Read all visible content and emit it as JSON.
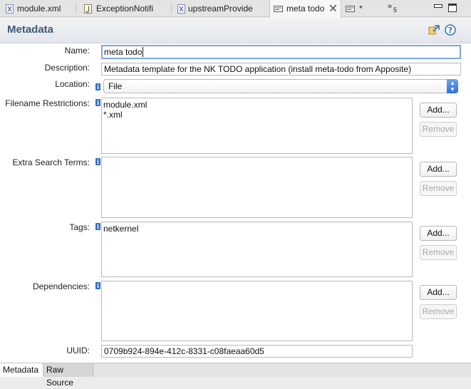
{
  "tabs": [
    {
      "label": "module.xml",
      "icon": "xml-file-icon"
    },
    {
      "label": "ExceptionNotifi",
      "icon": "java-file-icon"
    },
    {
      "label": "upstreamProvide",
      "icon": "xml-file-icon"
    },
    {
      "label": "meta todo",
      "icon": "metadata-editor-icon",
      "active": true
    },
    {
      "label": "*",
      "icon": "metadata-editor-icon"
    }
  ],
  "overflow": {
    "label": "»",
    "count": "5"
  },
  "header": {
    "title": "Metadata"
  },
  "form": {
    "name_label": "Name:",
    "name_value": "meta todo",
    "description_label": "Description:",
    "description_value": "Metadata template for the NK TODO application (install meta-todo from Apposite)",
    "location_label": "Location:",
    "location_value": "File",
    "filename_label": "Filename Restrictions:",
    "filename_lines": [
      "module.xml",
      "*.xml"
    ],
    "extra_label": "Extra Search Terms:",
    "tags_label": "Tags:",
    "tags_lines": [
      "netkernel"
    ],
    "deps_label": "Dependencies:",
    "uuid_label": "UUID:",
    "uuid_value": "0709b924-894e-412c-8331-c08faeaa60d5",
    "add_label": "Add...",
    "remove_label": "Remove"
  },
  "bottom_tabs": [
    {
      "label": "Metadata",
      "active": true
    },
    {
      "label": "Raw Source",
      "active": false
    }
  ],
  "colors": {
    "accent": "#3d5a7a",
    "focus": "#7ea6d9",
    "info": "#2f6fbf"
  }
}
